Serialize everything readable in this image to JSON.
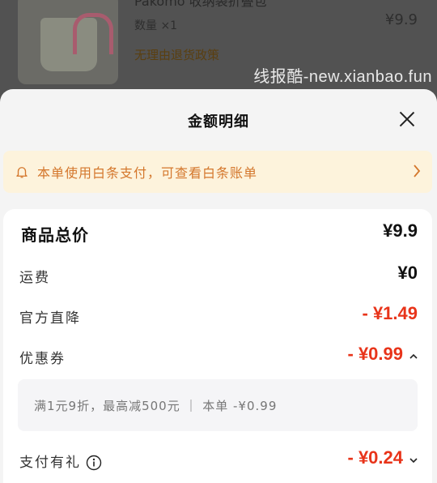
{
  "product": {
    "title": "Pakomo 收纳袋折叠包",
    "quantity": "数量 ×1",
    "price": "¥9.9",
    "return_policy": "无理由退货政策"
  },
  "watermark": "线报酷-new.xianbao.fun",
  "sheet": {
    "title": "金额明细",
    "notice": "本单使用白条支付，可查看白条账单",
    "rows": {
      "total": {
        "label": "商品总价",
        "value": "¥9.9"
      },
      "shipping": {
        "label": "运费",
        "value": "¥0"
      },
      "direct_discount": {
        "label": "官方直降",
        "value": "- ¥1.49"
      },
      "coupon": {
        "label": "优惠券",
        "value": "- ¥0.99"
      },
      "payment_gift": {
        "label": "支付有礼",
        "value": "- ¥0.24"
      }
    },
    "coupon_detail": "满1元9折，最高减500元 ｜ 本单 -¥0.99"
  },
  "colors": {
    "discount_red": "#e8341a",
    "notice_orange": "#d4772c",
    "notice_bg": "#fdf3dc"
  },
  "icons": [
    "close-icon",
    "bell-icon",
    "chevron-right-icon",
    "chevron-up-icon",
    "info-icon",
    "chevron-down-icon"
  ]
}
